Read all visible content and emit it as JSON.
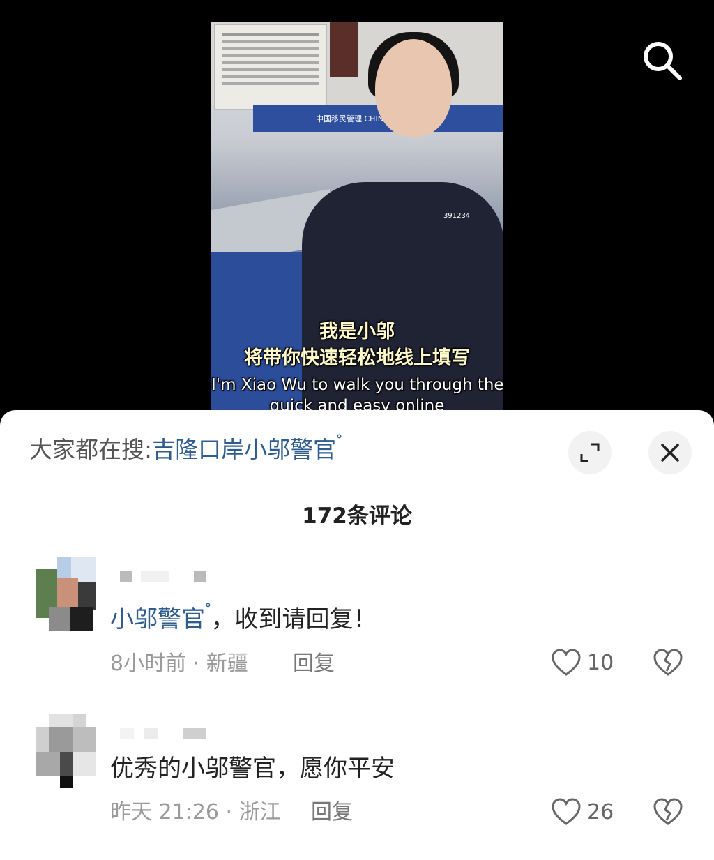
{
  "video": {
    "subtitle_line1": "我是小邬",
    "subtitle_line2": "将带你快速轻松地线上填写",
    "subtitle_line3": "I'm Xiao Wu to walk you through the",
    "subtitle_line4": "quick and easy online",
    "banner_text": "中国移民管理 CHINA IMMIGRATION",
    "badge_number": "391234"
  },
  "top_bar": {
    "search_icon": "search-icon"
  },
  "sheet": {
    "hot_search_prefix": "大家都在搜:",
    "hot_search_term": "吉隆口岸小邬警官",
    "comment_count": "172条评论",
    "expand_icon": "expand-icon",
    "close_icon": "close-icon"
  },
  "comments": [
    {
      "mention": "小邬警官",
      "text": "，收到请回复！",
      "meta": "8小时前 · 新疆",
      "reply": "回复",
      "likes": "10"
    },
    {
      "mention": "",
      "text": "优秀的小邬警官，愿你平安",
      "meta": "昨天 21:26 · 浙江",
      "reply": "回复",
      "likes": "26"
    }
  ]
}
